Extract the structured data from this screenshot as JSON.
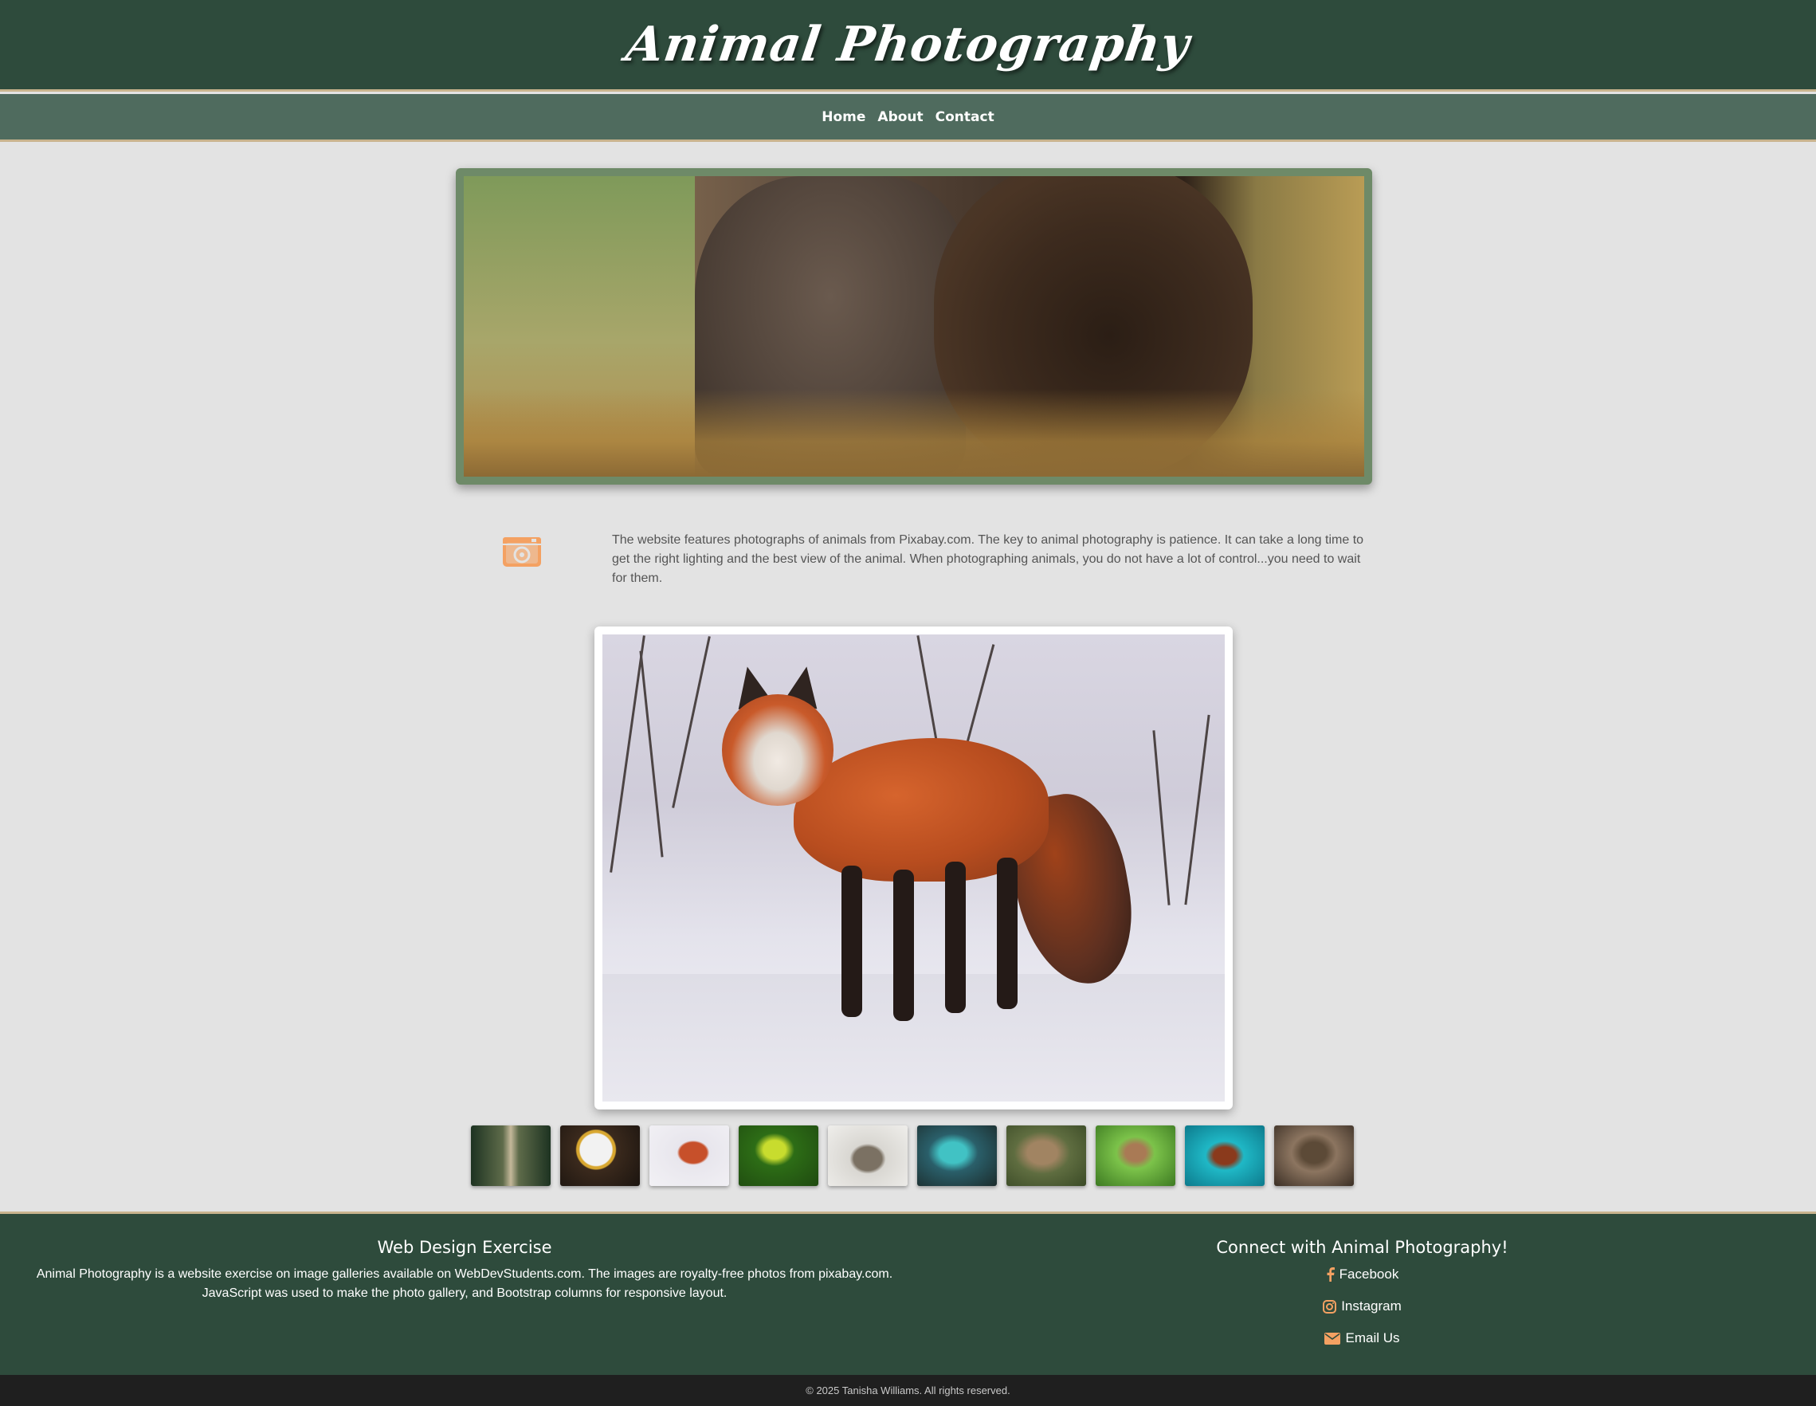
{
  "header": {
    "title": "Animal Photography"
  },
  "nav": {
    "items": [
      "Home",
      "About",
      "Contact"
    ]
  },
  "intro": {
    "icon": "camera-icon",
    "text": "The website features photographs of animals from Pixabay.com. The key to animal photography is patience. It can take a long time to get the right lighting and the best view of the animal. When photographing animals, you do not have a lot of control...you need to wait for them."
  },
  "gallery": {
    "thumbnails": [
      "deer",
      "eagle",
      "fox",
      "frog",
      "hedgehog",
      "lizard",
      "otter",
      "rabbit",
      "turtle",
      "spider"
    ]
  },
  "footer": {
    "left": {
      "heading": "Web Design Exercise",
      "text": "Animal Photography is a website exercise on image galleries available on WebDevStudents.com. The images are royalty-free photos from pixabay.com. JavaScript was used to make the photo gallery, and Bootstrap columns for responsive layout."
    },
    "right": {
      "heading": "Connect with Animal Photography!",
      "links": [
        {
          "label": "Facebook",
          "icon": "facebook-icon"
        },
        {
          "label": "Instagram",
          "icon": "instagram-icon"
        },
        {
          "label": "Email Us",
          "icon": "envelope-icon"
        }
      ]
    },
    "copyright": "© 2025 Tanisha Williams. All rights reserved."
  },
  "colors": {
    "header_bg": "#2e4b3c",
    "nav_bg": "#4f6b5e",
    "accent": "#c9b48e",
    "icon_orange": "#f4a162",
    "page_bg": "#e3e3e3"
  }
}
